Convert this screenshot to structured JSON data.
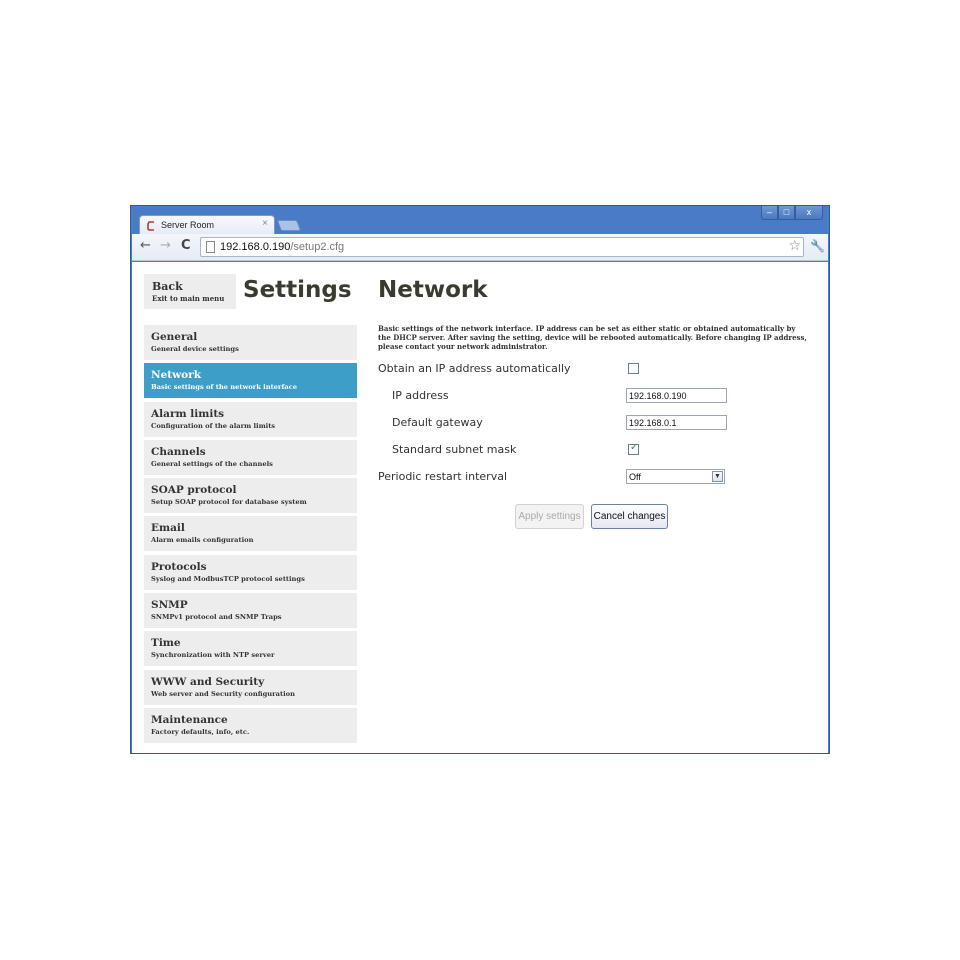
{
  "browser": {
    "tab_title": "Server Room",
    "tab_close": "×",
    "url_host": "192.168.0.190",
    "url_path": "/setup2.cfg",
    "window_buttons": {
      "minimize": "–",
      "maximize": "□",
      "close": "x"
    },
    "accent_color": "#4a7bc7"
  },
  "back": {
    "title": "Back",
    "subtitle": "Exit to main menu"
  },
  "settings_title": "Settings",
  "menu": {
    "active_color": "#3d9ec8",
    "items": [
      {
        "title": "General",
        "subtitle": "General device settings"
      },
      {
        "title": "Network",
        "subtitle": "Basic settings of the network interface"
      },
      {
        "title": "Alarm limits",
        "subtitle": "Configuration of the alarm limits"
      },
      {
        "title": "Channels",
        "subtitle": "General settings of the channels"
      },
      {
        "title": "SOAP protocol",
        "subtitle": "Setup SOAP protocol for database system"
      },
      {
        "title": "Email",
        "subtitle": "Alarm emails configuration"
      },
      {
        "title": "Protocols",
        "subtitle": "Syslog and ModbusTCP protocol settings"
      },
      {
        "title": "SNMP",
        "subtitle": "SNMPv1 protocol and SNMP Traps"
      },
      {
        "title": "Time",
        "subtitle": "Synchronization with NTP server"
      },
      {
        "title": "WWW and Security",
        "subtitle": "Web server and Security configuration"
      },
      {
        "title": "Maintenance",
        "subtitle": "Factory defaults, info, etc."
      }
    ]
  },
  "page": {
    "title": "Network",
    "description": "Basic settings of the network interface. IP address can be set as either static or obtained automatically by the DHCP server. After saving the setting, device will be rebooted automatically. Before changing IP address, please contact your network administrator."
  },
  "form": {
    "dhcp_label": "Obtain an IP address automatically",
    "dhcp_checked": false,
    "ip_label": "IP address",
    "ip_value": "192.168.0.190",
    "gateway_label": "Default gateway",
    "gateway_value": "192.168.0.1",
    "subnet_label": "Standard subnet mask",
    "subnet_checked": true,
    "restart_label": "Periodic restart interval",
    "restart_value": "Off"
  },
  "buttons": {
    "apply": "Apply settings",
    "cancel": "Cancel changes"
  }
}
